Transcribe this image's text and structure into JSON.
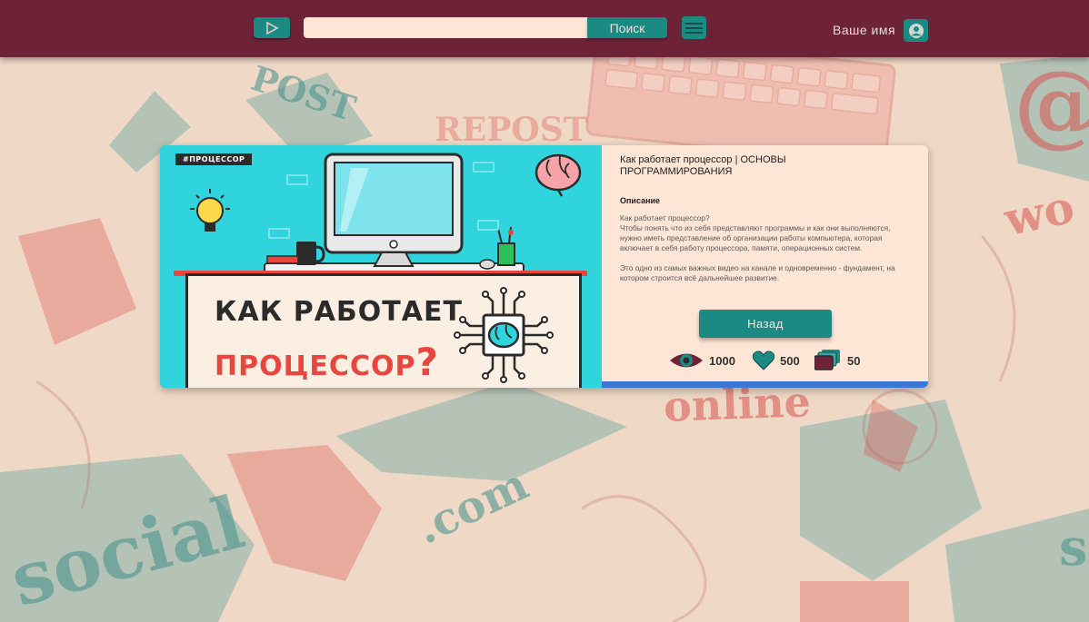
{
  "header": {
    "search": {
      "placeholder": "",
      "value": ""
    },
    "search_button_label": "Поиск",
    "user_name": "Ваше имя",
    "icons": [
      "play-icon",
      "menu-icon",
      "user-icon"
    ]
  },
  "background": {
    "doodles": [
      "POST",
      "REPOST",
      "online",
      ".com",
      "social",
      "wo",
      "s",
      "@"
    ]
  },
  "card": {
    "thumbnail": {
      "tag": "#ПРОЦЕССОР",
      "line1": "КАК РАБОТАЕТ",
      "line2": "ПРОЦЕССОР",
      "line2_mark": "?"
    },
    "title": "Как работает процессор | ОСНОВЫ ПРОГРАММИРОВАНИЯ",
    "description_label": "Описание",
    "description": [
      "Как работает процессор?\nЧтобы понять что из себя представляют программы и как они выполняются, нужно иметь представление об организации работы компьютера, которая включает в себя работу процессора, памяти, операционных систем.",
      "Это одно из самых важных видео на канале и одновременно - фундамент, на котором строится всё дальнейшее развитие."
    ],
    "back_button_label": "Назад",
    "stats": {
      "views": "1000",
      "likes": "500",
      "saves": "50"
    }
  },
  "colors": {
    "header": "#6e2238",
    "accent": "#1b8a83",
    "card": "#fde6d5",
    "thumbnail": "#2fd4dc",
    "bar": "#3b78d6"
  }
}
